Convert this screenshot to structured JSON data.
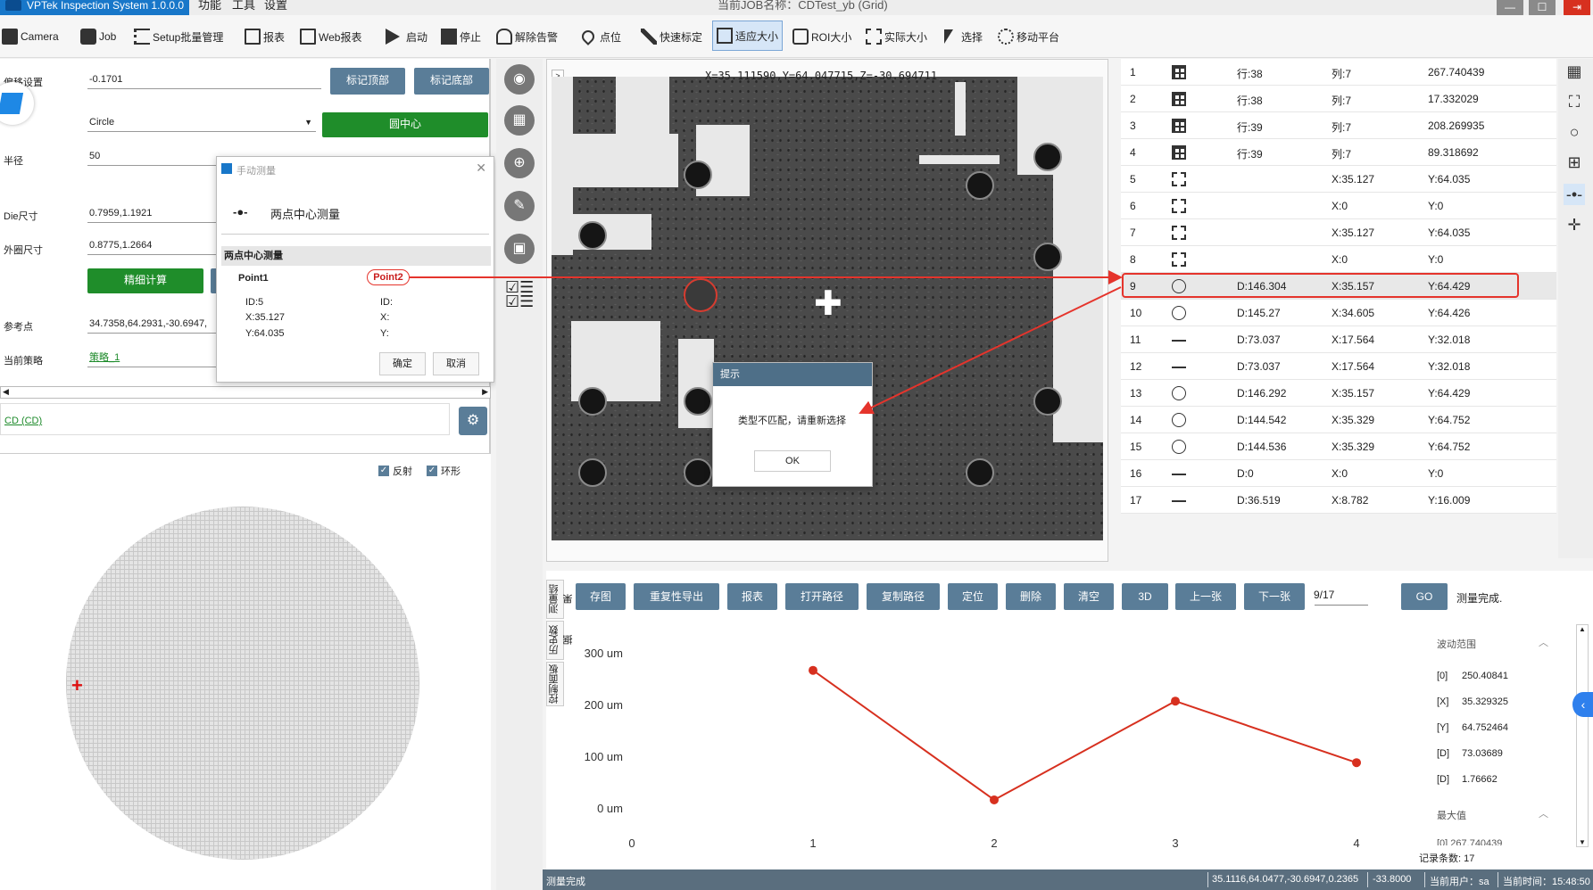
{
  "app": {
    "title": "VPTek Inspection System 1.0.0.0",
    "menu": [
      "功能",
      "工具",
      "设置"
    ],
    "job_title": "当前JOB名称：CDTest_yb (Grid)"
  },
  "toolbar": [
    "Camera",
    "Job",
    "Setup批量管理",
    "报表",
    "Web报表",
    "启动",
    "停止",
    "解除告警",
    "点位",
    "快速标定",
    "适应大小",
    "ROI大小",
    "实际大小",
    "选择",
    "移动平台"
  ],
  "left": {
    "offset_label": "偏移设置",
    "offset_value": "-0.1701",
    "btn_mark_top": "标记顶部",
    "btn_mark_bottom": "标记底部",
    "shape_value": "Circle",
    "btn_center": "圆中心",
    "radius_label": "半径",
    "radius_value": "50",
    "die_label": "Die尺寸",
    "die_value": "0.7959,1.1921",
    "outer_label": "外圈尺寸",
    "outer_value": "0.8775,1.2664",
    "btn_fine": "精细计算",
    "ref_label": "参考点",
    "ref_value": "34.7358,64.2931,-30.6947,",
    "strategy_label": "当前策略",
    "strategy_value": "策略_1",
    "cd_link": "CD (CD)",
    "chk_reflect": "反射",
    "chk_ring": "环形"
  },
  "popup": {
    "title": "手动测量",
    "mode": "两点中心测量",
    "section": "两点中心测量",
    "point1_label": "Point1",
    "point2_label": "Point2",
    "p1_id": "ID:5",
    "p1_x": "X:35.127",
    "p1_y": "Y:64.035",
    "p2_id": "ID:",
    "p2_x": "X:",
    "p2_y": "Y:",
    "btn_ok": "确定",
    "btn_cancel": "取消"
  },
  "image": {
    "coords": "X=35.111590,Y=64.047715,Z=-30.694711"
  },
  "dialog": {
    "title": "提示",
    "message": "类型不匹配，请重新选择",
    "ok": "OK"
  },
  "table": [
    {
      "n": "1",
      "icon": "grid",
      "a": "",
      "b": "行:38",
      "c": "列:7",
      "d": "267.740439"
    },
    {
      "n": "2",
      "icon": "grid",
      "a": "",
      "b": "行:38",
      "c": "列:7",
      "d": "17.332029"
    },
    {
      "n": "3",
      "icon": "grid",
      "a": "",
      "b": "行:39",
      "c": "列:7",
      "d": "208.269935"
    },
    {
      "n": "4",
      "icon": "grid",
      "a": "",
      "b": "行:39",
      "c": "列:7",
      "d": "89.318692"
    },
    {
      "n": "5",
      "icon": "focus",
      "a": "",
      "b": "",
      "c": "X:35.127",
      "d": "Y:64.035"
    },
    {
      "n": "6",
      "icon": "focus",
      "a": "",
      "b": "",
      "c": "X:0",
      "d": "Y:0"
    },
    {
      "n": "7",
      "icon": "focus",
      "a": "",
      "b": "",
      "c": "X:35.127",
      "d": "Y:64.035"
    },
    {
      "n": "8",
      "icon": "focus",
      "a": "",
      "b": "",
      "c": "X:0",
      "d": "Y:0"
    },
    {
      "n": "9",
      "icon": "circle",
      "a": "",
      "b": "D:146.304",
      "c": "X:35.157",
      "d": "Y:64.429"
    },
    {
      "n": "10",
      "icon": "circle",
      "a": "",
      "b": "D:145.27",
      "c": "X:34.605",
      "d": "Y:64.426"
    },
    {
      "n": "11",
      "icon": "line",
      "a": "",
      "b": "D:73.037",
      "c": "X:17.564",
      "d": "Y:32.018"
    },
    {
      "n": "12",
      "icon": "line",
      "a": "",
      "b": "D:73.037",
      "c": "X:17.564",
      "d": "Y:32.018"
    },
    {
      "n": "13",
      "icon": "circle",
      "a": "",
      "b": "D:146.292",
      "c": "X:35.157",
      "d": "Y:64.429"
    },
    {
      "n": "14",
      "icon": "circle",
      "a": "",
      "b": "D:144.542",
      "c": "X:35.329",
      "d": "Y:64.752"
    },
    {
      "n": "15",
      "icon": "circle",
      "a": "",
      "b": "D:144.536",
      "c": "X:35.329",
      "d": "Y:64.752"
    },
    {
      "n": "16",
      "icon": "line",
      "a": "",
      "b": "D:0",
      "c": "X:0",
      "d": "Y:0"
    },
    {
      "n": "17",
      "icon": "line",
      "a": "",
      "b": "D:36.519",
      "c": "X:8.782",
      "d": "Y:16.009"
    }
  ],
  "chart_buttons": [
    "存图",
    "重复性导出",
    "报表",
    "打开路径",
    "复制路径",
    "定位",
    "删除",
    "清空",
    "3D",
    "上一张",
    "下一张"
  ],
  "page_indicator": "9/17",
  "go": "GO",
  "measure_status": "测量完成.",
  "side_tabs": [
    "测量结果",
    "历史数据",
    "控制面板"
  ],
  "chart_data": {
    "type": "line",
    "x": [
      1,
      2,
      3,
      4
    ],
    "values": [
      267.740439,
      17.332029,
      208.269935,
      89.318692
    ],
    "xticks": [
      "0",
      "1",
      "2",
      "3",
      "4"
    ],
    "yticks": [
      "0 um",
      "100 um",
      "200 um",
      "300 um"
    ],
    "xlim": [
      0,
      4
    ],
    "ylim": [
      0,
      300
    ],
    "color": "#d7301f"
  },
  "stats": {
    "range_title": "波动范围",
    "range_items": [
      {
        "k": "[0]",
        "v": "250.40841"
      },
      {
        "k": "[X]",
        "v": "35.329325"
      },
      {
        "k": "[Y]",
        "v": "64.752464"
      },
      {
        "k": "[D]",
        "v": "73.03689"
      },
      {
        "k": "[D]",
        "v": "1.76662"
      }
    ],
    "max_title": "最大值",
    "max_partial": "[0]   267.740439",
    "record_count": "记录条数: 17"
  },
  "status": {
    "left": "测量完成",
    "coords": "35.1116,64.0477,-30.6947,0.2365",
    "z": "-33.8000",
    "user": "当前用户：sa",
    "time": "当前时间：15:48:50"
  }
}
